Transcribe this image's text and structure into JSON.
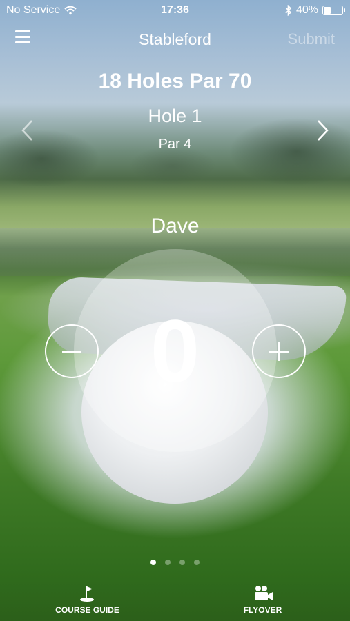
{
  "status_bar": {
    "carrier": "No Service",
    "time": "17:36",
    "battery": "40%",
    "battery_level": 0.4
  },
  "nav": {
    "title": "Stableford",
    "submit_label": "Submit"
  },
  "hole_info": {
    "course": "18 Holes Par 70",
    "hole": "Hole 1",
    "par": "Par 4"
  },
  "player": {
    "name": "Dave",
    "score": "0"
  },
  "pagination": {
    "count": 4,
    "active_index": 0
  },
  "tabs": [
    {
      "label": "COURSE GUIDE",
      "icon": "golf-flag-icon"
    },
    {
      "label": "FLYOVER",
      "icon": "video-camera-icon"
    }
  ]
}
